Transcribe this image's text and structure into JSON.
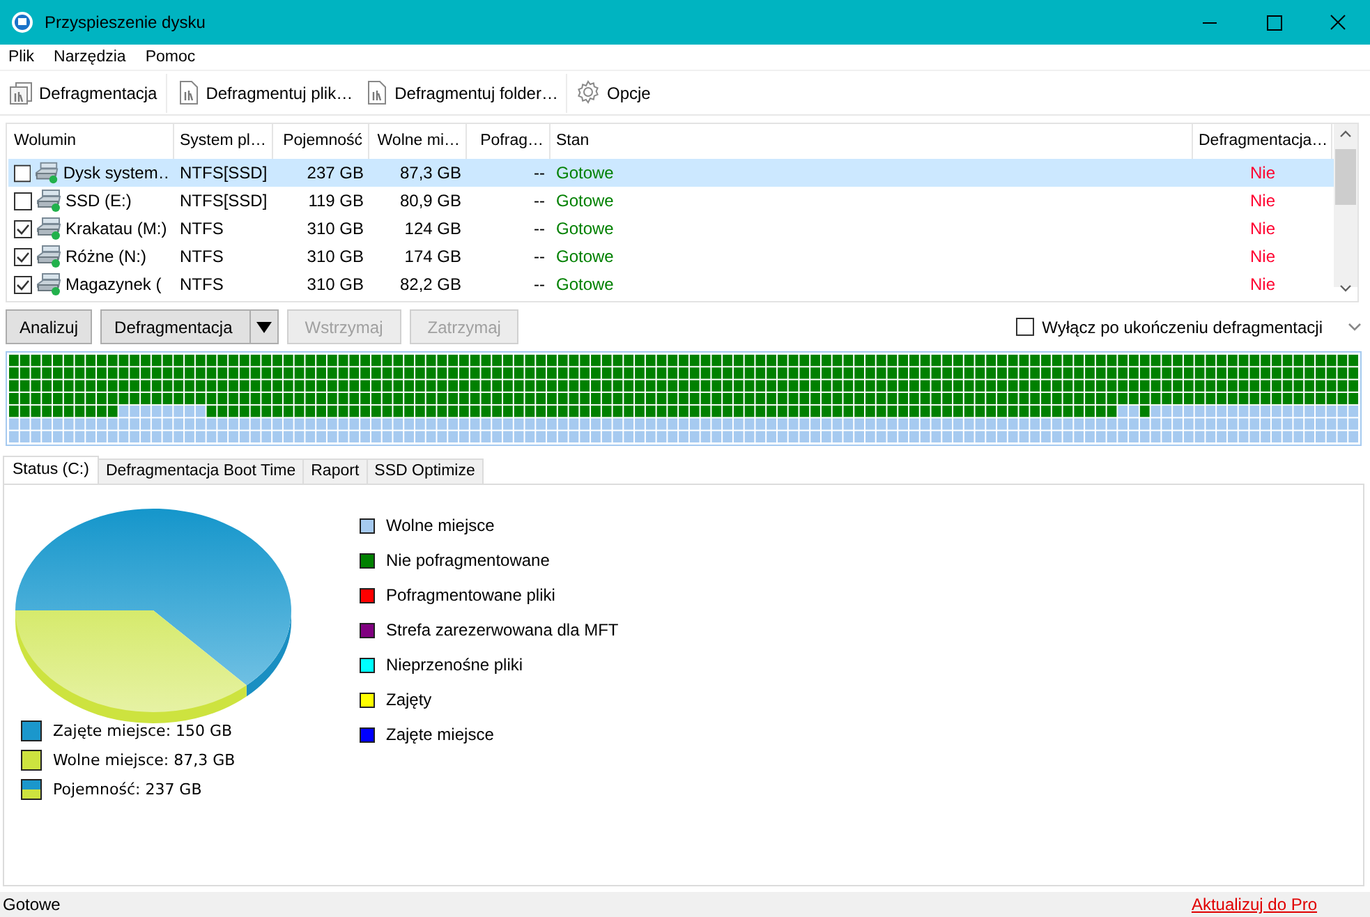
{
  "window": {
    "title": "Przyspieszenie dysku"
  },
  "menu": [
    {
      "label": "Plik"
    },
    {
      "label": "Narzędzia"
    },
    {
      "label": "Pomoc"
    }
  ],
  "toolbar": [
    {
      "label": "Defragmentacja",
      "kind": "disk"
    },
    {
      "label": "Defragmentuj plik…",
      "kind": "file"
    },
    {
      "label": "Defragmentuj folder…",
      "kind": "file"
    },
    {
      "label": "Opcje",
      "kind": "gear"
    }
  ],
  "volumes": {
    "columns": [
      "Wolumin",
      "System pl…",
      "Pojemność",
      "Wolne mi…",
      "Pofrag…",
      "Stan",
      "Defragmentacja…"
    ],
    "rows": [
      {
        "checked": false,
        "selected": true,
        "cells": [
          "Dysk system…",
          "NTFS[SSD]",
          "237 GB",
          "87,3 GB",
          "--",
          "Gotowe",
          "Nie"
        ]
      },
      {
        "checked": false,
        "selected": false,
        "cells": [
          "SSD (E:)",
          "NTFS[SSD]",
          "119 GB",
          "80,9 GB",
          "--",
          "Gotowe",
          "Nie"
        ]
      },
      {
        "checked": true,
        "selected": false,
        "cells": [
          "Krakatau (M:)",
          "NTFS",
          "310 GB",
          "124 GB",
          "--",
          "Gotowe",
          "Nie"
        ]
      },
      {
        "checked": true,
        "selected": false,
        "cells": [
          "Różne (N:)",
          "NTFS",
          "310 GB",
          "174 GB",
          "--",
          "Gotowe",
          "Nie"
        ]
      },
      {
        "checked": true,
        "selected": false,
        "cells": [
          "Magazynek (",
          "NTFS",
          "310 GB",
          "82,2 GB",
          "--",
          "Gotowe",
          "Nie"
        ]
      }
    ]
  },
  "actions": [
    {
      "label": "Analizuj",
      "disabled": false,
      "kind": "button"
    },
    {
      "label": "Defragmentacja",
      "disabled": false,
      "kind": "split"
    },
    {
      "label": "Wstrzymaj",
      "disabled": true,
      "kind": "button"
    },
    {
      "label": "Zatrzymaj",
      "disabled": true,
      "kind": "button"
    }
  ],
  "shutdown_option": {
    "label": "Wyłącz po ukończeniu defragmentacji",
    "checked": false
  },
  "tabs": [
    {
      "label": "Status (C:)",
      "selected": true
    },
    {
      "label": "Defragmentacja Boot Time",
      "selected": false
    },
    {
      "label": "Raport",
      "selected": false
    },
    {
      "label": "SSD Optimize",
      "selected": false
    }
  ],
  "disk_chart": {
    "legend": [
      {
        "label": "Zajęte miejsce: 150 GB",
        "color": "#1b97cc"
      },
      {
        "label": "Wolne miejsce: 87,3 GB",
        "color": "#cde33f"
      },
      {
        "label": "Pojemność: 237 GB",
        "kind": "split"
      }
    ]
  },
  "map_legend": [
    {
      "label": "Wolne miejsce",
      "color": "#a6caf0"
    },
    {
      "label": "Nie pofragmentowane",
      "color": "#008000"
    },
    {
      "label": "Pofragmentowane pliki",
      "color": "#ff0000"
    },
    {
      "label": "Strefa zarezerwowana dla MFT",
      "color": "#800080"
    },
    {
      "label": "Nieprzenośne pliki",
      "color": "#00ffff"
    },
    {
      "label": "Zajęty",
      "color": "#ffff00"
    },
    {
      "label": "Zajęte miejsce",
      "color": "#0000ff"
    }
  ],
  "status_bar": {
    "text": "Gotowe",
    "link": "Aktualizuj do Pro"
  }
}
